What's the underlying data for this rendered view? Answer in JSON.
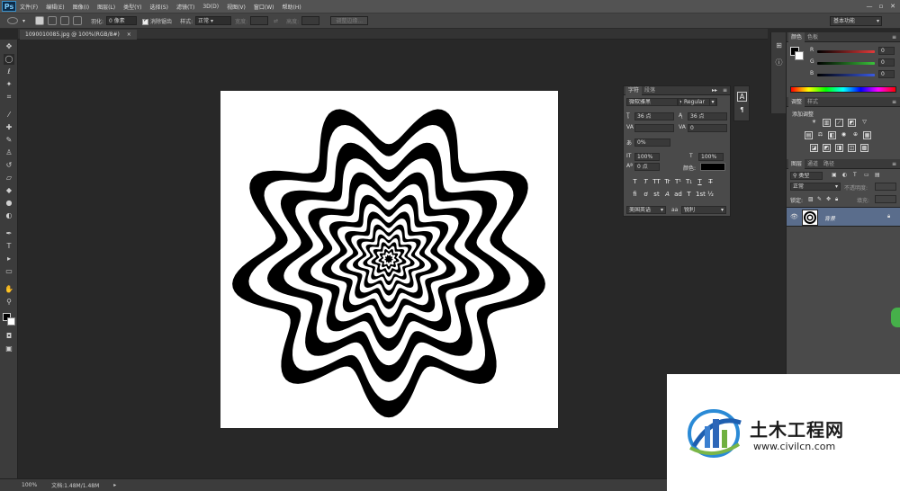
{
  "app": {
    "logo": "Ps"
  },
  "menu": [
    "文件(F)",
    "编辑(E)",
    "图像(I)",
    "图层(L)",
    "类型(Y)",
    "选择(S)",
    "滤镜(T)",
    "3D(D)",
    "视图(V)",
    "窗口(W)",
    "帮助(H)"
  ],
  "window_controls": [
    "—",
    "▫",
    "✕"
  ],
  "options": {
    "feather_label": "羽化:",
    "feather_value": "0 像素",
    "antialias_label": "消除锯齿",
    "style_label": "样式:",
    "style_value": "正常",
    "width_label": "宽度:",
    "height_label": "高度:",
    "refine_edge": "调整边缘...",
    "workspace": "基本功能"
  },
  "document": {
    "tab_title": "1090010085.jpg @ 100%(RGB/8#)",
    "close_glyph": "×"
  },
  "status": {
    "zoom": "100%",
    "doc_info": "文档:1.48M/1.48M"
  },
  "character_panel": {
    "tabs": [
      "字符",
      "段落"
    ],
    "font_family": "微软雅黑",
    "font_style": "Regular",
    "font_size": "36 点",
    "leading": "36 点",
    "kerning": "",
    "tracking": "0",
    "scale_pct": "0%",
    "vertical_scale": "100%",
    "horizontal_scale": "100%",
    "baseline": "0 点",
    "color_label": "颜色:",
    "format_buttons": [
      "T",
      "T",
      "TT",
      "Tr",
      "T¹",
      "T₁",
      "T",
      "T̶"
    ],
    "ot_buttons": [
      "fi",
      "ơ",
      "st",
      "A",
      "ad",
      "T",
      "1st",
      "½"
    ],
    "language": "美国英语",
    "aa_label": "aa",
    "antialias": "锐利"
  },
  "color_panel": {
    "tabs": [
      "颜色",
      "色板"
    ],
    "channels": [
      {
        "name": "R",
        "value": "0",
        "color": "#e23a3a"
      },
      {
        "name": "G",
        "value": "0",
        "color": "#3ac23a"
      },
      {
        "name": "B",
        "value": "0",
        "color": "#3a5ae2"
      }
    ]
  },
  "adjustments_panel": {
    "tabs": [
      "调整",
      "样式"
    ],
    "add_label": "添加调整"
  },
  "layers_panel": {
    "tabs": [
      "图层",
      "通道",
      "路径"
    ],
    "kind": "类型",
    "blend_mode": "正常",
    "opacity_label": "不透明度:",
    "lock_label": "锁定:",
    "fill_label": "填充:",
    "layer_name": "背景"
  },
  "watermark": {
    "cn": "土木工程网",
    "url": "www.civilcn.com"
  }
}
